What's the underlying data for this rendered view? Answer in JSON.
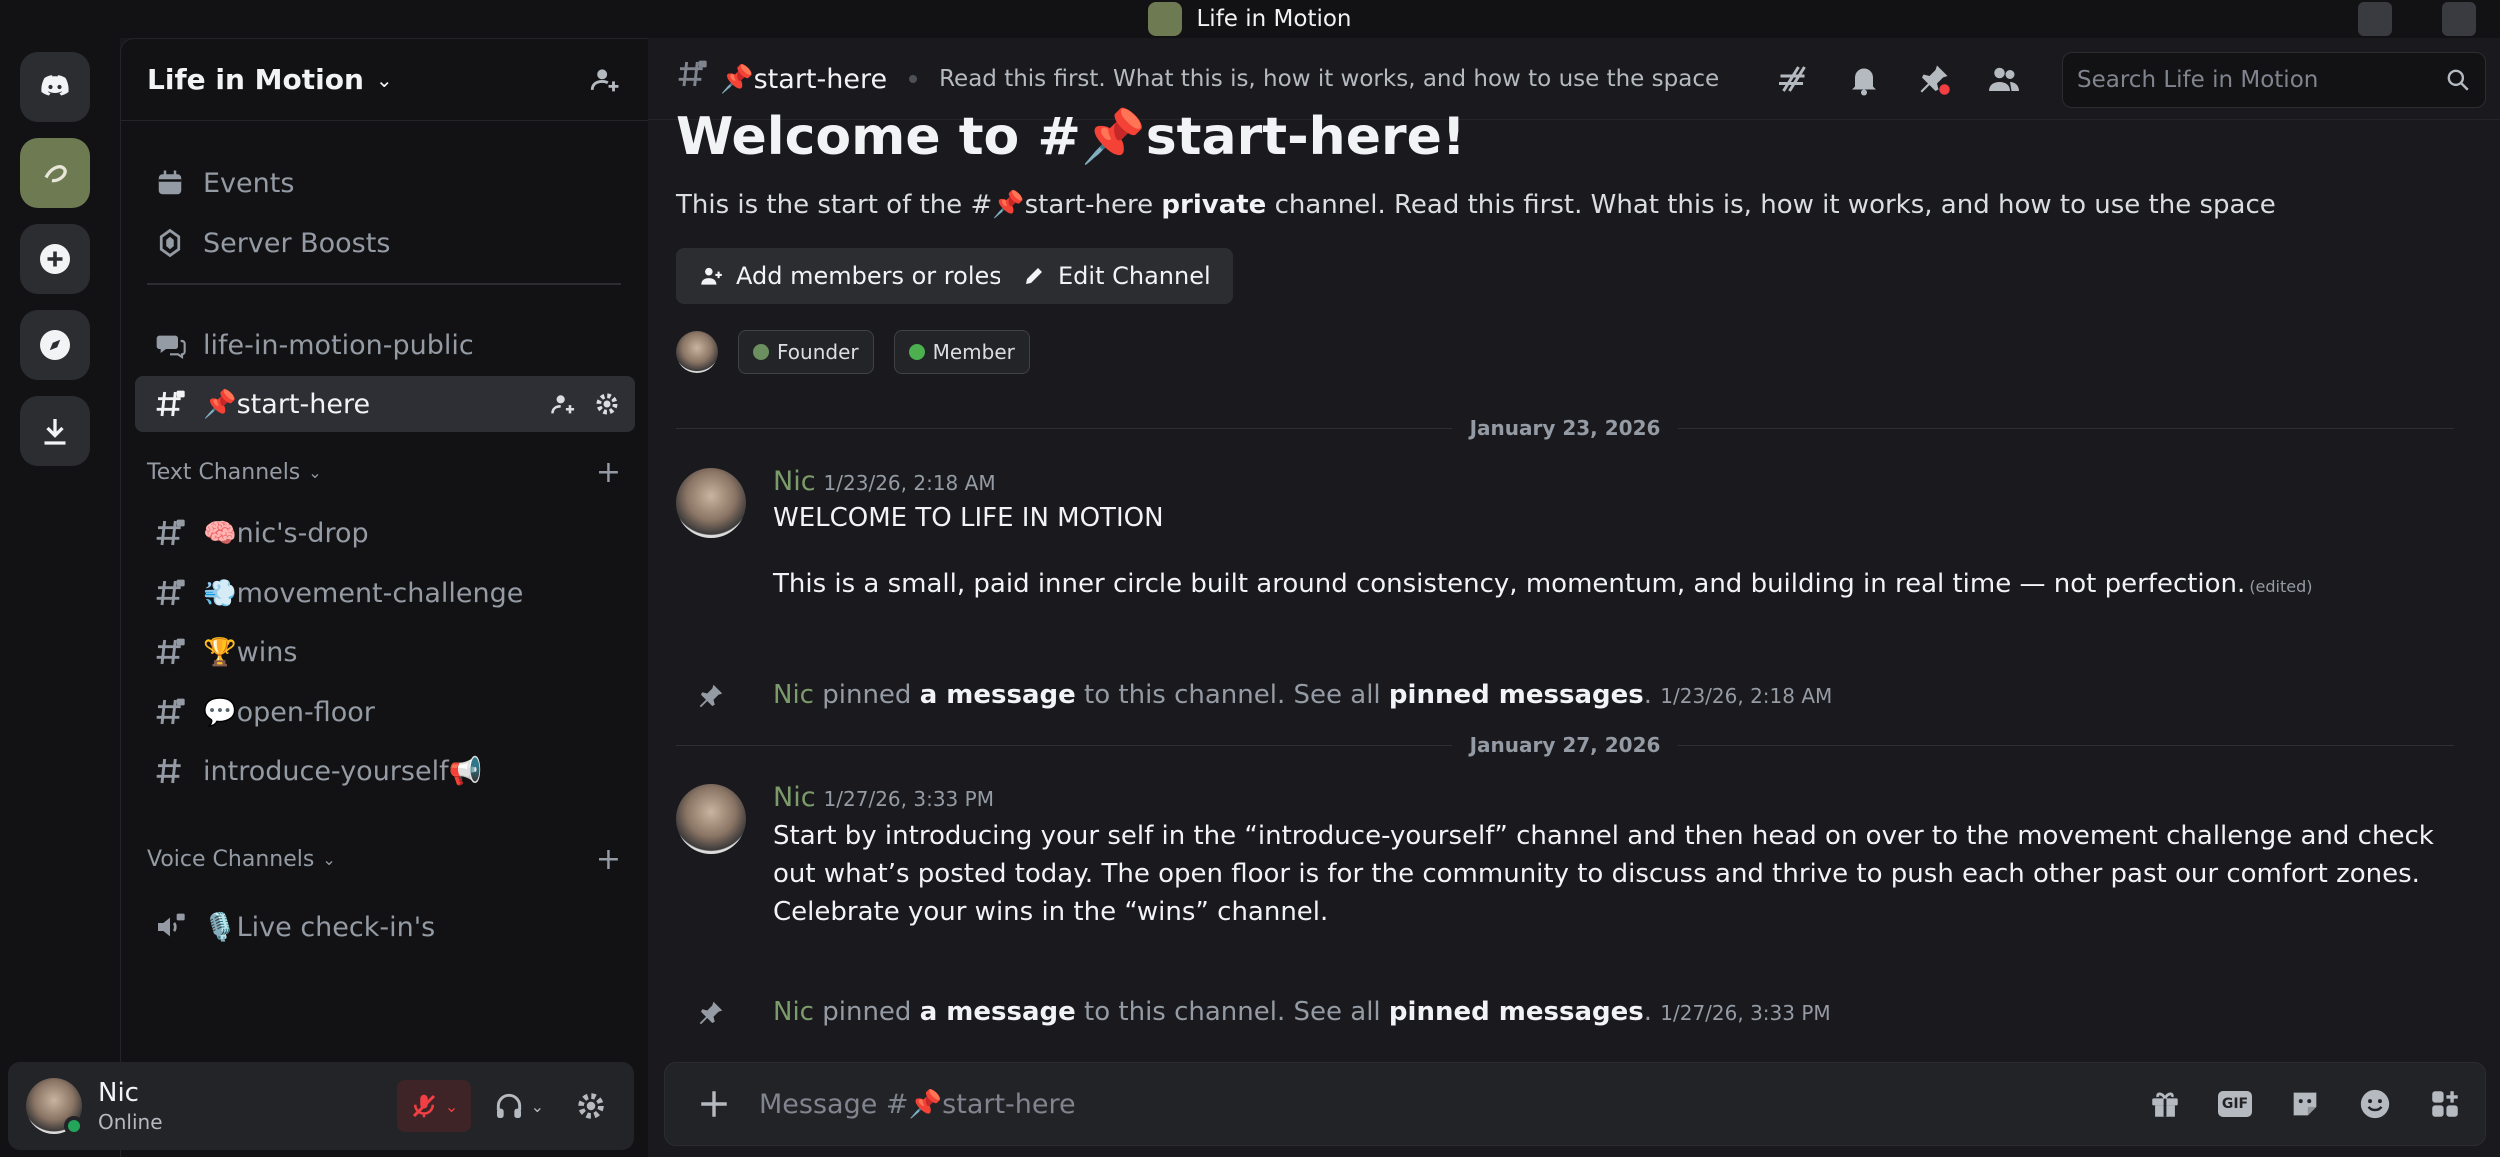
{
  "window": {
    "title": "Life in Motion"
  },
  "server": {
    "name": "Life in Motion"
  },
  "sidebar": {
    "top_items": [
      {
        "label": "Events"
      },
      {
        "label": "Server Boosts"
      }
    ],
    "public_channel": "life-in-motion-public",
    "active_channel": "📌start-here",
    "text_category": "Text Channels",
    "text_channels": [
      "🧠nic's-drop",
      "💨movement-challenge",
      "🏆wins",
      "💬open-floor",
      "introduce-yourself📢"
    ],
    "voice_category": "Voice Channels",
    "voice_channels": [
      "🎙️Live check-in's"
    ]
  },
  "user": {
    "name": "Nic",
    "status": "Online"
  },
  "header": {
    "channel": "📌start-here",
    "topic": "Read this first. What this is, how it works, and how to use the space",
    "search_placeholder": "Search Life in Motion"
  },
  "welcome": {
    "title": "Welcome to #📌start-here!",
    "desc_prefix": "This is the start of the #📌start-here ",
    "desc_bold": "private",
    "desc_suffix": " channel. Read this first. What this is, how it works, and how to use the space",
    "add_members": "Add members or roles",
    "edit_channel": "Edit Channel",
    "roles": [
      {
        "name": "Founder",
        "color": "#6b8f5e"
      },
      {
        "name": "Member",
        "color": "#4caf50"
      }
    ]
  },
  "messages": {
    "date1": "January 23, 2026",
    "m1": {
      "author": "Nic",
      "ts": "1/23/26, 2:18 AM",
      "line1": "WELCOME TO LIFE IN MOTION",
      "line2": "This is a small, paid inner circle built around consistency, momentum, and building in real time — not perfection.",
      "edited": "(edited)"
    },
    "pin1": {
      "author": "Nic",
      "t1": " pinned ",
      "b1": "a message",
      "t2": " to this channel. See all ",
      "b2": "pinned messages",
      "t3": ". ",
      "ts": "1/23/26, 2:18 AM"
    },
    "date2": "January 27, 2026",
    "m2": {
      "author": "Nic",
      "ts": "1/27/26, 3:33 PM",
      "text": "Start by introducing your self in the “introduce-yourself” channel and then head on over to the movement challenge and check out what’s posted today. The open floor is for the community to discuss and thrive to push each other past our comfort zones. Celebrate your wins in the “wins” channel."
    },
    "pin2": {
      "author": "Nic",
      "t1": " pinned ",
      "b1": "a message",
      "t2": " to this channel. See all ",
      "b2": "pinned messages",
      "t3": ". ",
      "ts": "1/27/26, 3:33 PM"
    }
  },
  "composer": {
    "placeholder": "Message #📌start-here",
    "gif": "GIF"
  },
  "colors": {
    "accent": "#7b9b6a",
    "online": "#23a55a",
    "muted": "#f23f43"
  }
}
